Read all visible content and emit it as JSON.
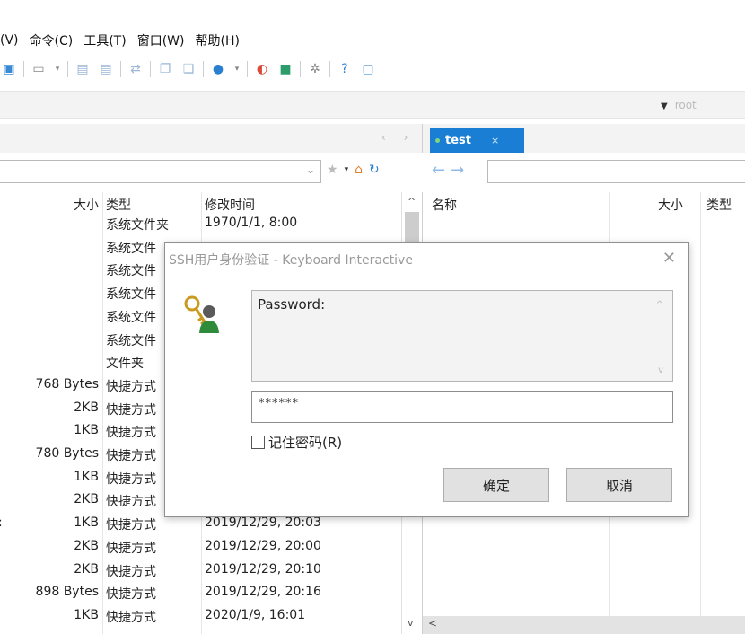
{
  "menu": [
    "(V)",
    "命令(C)",
    "工具(T)",
    "窗口(W)",
    "帮助(H)"
  ],
  "toolbar_icons": [
    "session-settings-icon",
    "terminal-icon",
    "document-icon",
    "document-icon",
    "transfer-icon",
    "copy-icon",
    "paste-icon",
    "globe-icon",
    "bell-icon",
    "app-icon",
    "gear-icon",
    "help-icon",
    "chat-icon"
  ],
  "user_drop": {
    "value": "root"
  },
  "left_nav_arrows": "‹ ›",
  "tab": {
    "label": "test",
    "close": "×",
    "status_color": "#7ed67e"
  },
  "left_pane": {
    "headers": {
      "size": "大小",
      "type": "类型",
      "date": "修改时间"
    },
    "rows": [
      {
        "size": "",
        "type": "系统文件夹",
        "date": "1970/1/1, 8:00"
      },
      {
        "size": "",
        "type": "系统文件",
        "date": ""
      },
      {
        "size": "",
        "type": "系统文件",
        "date": ""
      },
      {
        "size": "",
        "type": "系统文件",
        "date": ""
      },
      {
        "size": "",
        "type": "系统文件",
        "date": ""
      },
      {
        "size": "",
        "type": "系统文件",
        "date": ""
      },
      {
        "size": "",
        "type": "文件夹",
        "date": ""
      },
      {
        "size": "768 Bytes",
        "type": "快捷方式",
        "date": ""
      },
      {
        "size": "2KB",
        "type": "快捷方式",
        "date": ""
      },
      {
        "size": "1KB",
        "type": "快捷方式",
        "date": ""
      },
      {
        "size": "780 Bytes",
        "type": "快捷方式",
        "date": ""
      },
      {
        "size": "1KB",
        "type": "快捷方式",
        "date": ""
      },
      {
        "size": "2KB",
        "type": "快捷方式",
        "date": ""
      },
      {
        "size": "1KB",
        "type": "快捷方式",
        "date": "2019/12/29, 20:03",
        "mark": ":"
      },
      {
        "size": "2KB",
        "type": "快捷方式",
        "date": "2019/12/29, 20:00"
      },
      {
        "size": "2KB",
        "type": "快捷方式",
        "date": "2019/12/29, 20:10"
      },
      {
        "size": "898 Bytes",
        "type": "快捷方式",
        "date": "2019/12/29, 20:16"
      },
      {
        "size": "1KB",
        "type": "快捷方式",
        "date": "2020/1/9, 16:01"
      }
    ]
  },
  "right_pane": {
    "headers": {
      "name": "名称",
      "size": "大小",
      "type": "类型"
    }
  },
  "dialog": {
    "title": "SSH用户身份验证 - Keyboard Interactive",
    "prompt": "Password:",
    "password_mask": "******",
    "remember_label": "记住密码(R)",
    "ok_label": "确定",
    "cancel_label": "取消"
  }
}
